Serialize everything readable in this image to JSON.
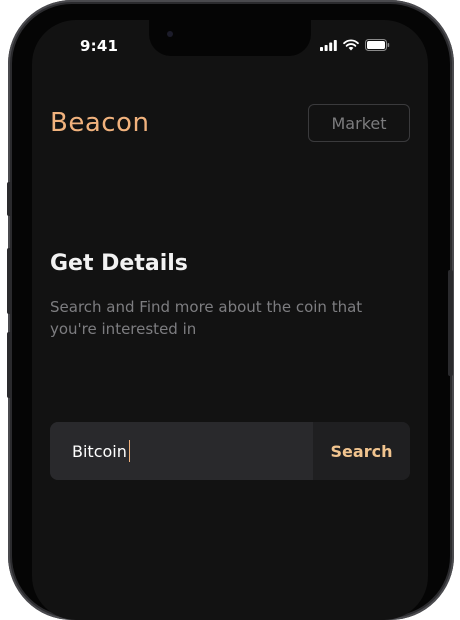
{
  "status_bar": {
    "time": "9:41",
    "icons": [
      "cellular-signal-icon",
      "wifi-icon",
      "battery-icon"
    ]
  },
  "header": {
    "logo": "Beacon",
    "market_button": "Market"
  },
  "main": {
    "title": "Get Details",
    "subtitle": "Search and Find more about the coin that you're interested in",
    "search": {
      "value": "Bitcoin",
      "button_label": "Search"
    }
  },
  "colors": {
    "accent": "#f1b27d",
    "background": "#121212",
    "search_bg": "#29292c"
  }
}
